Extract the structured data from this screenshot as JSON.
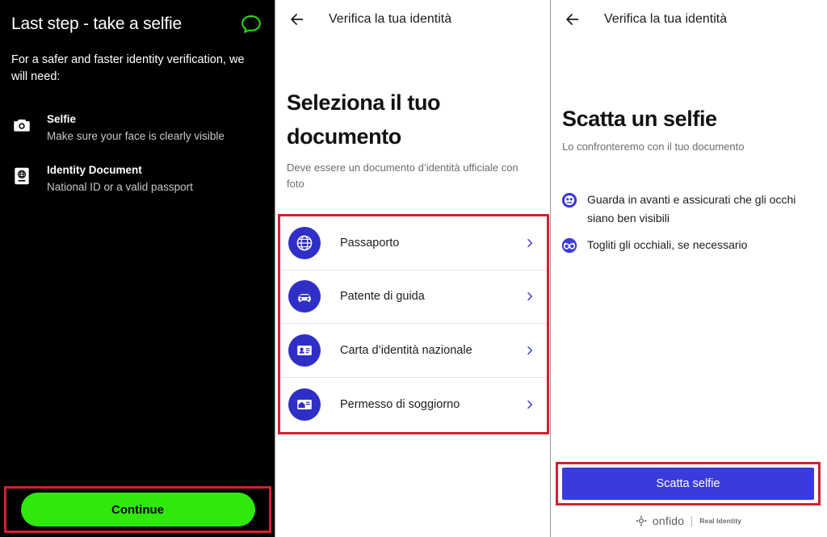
{
  "panel1": {
    "title": "Last step - take a selfie",
    "chat_icon": "chat-bubble-icon",
    "subtitle": "For a safer and faster identity verification, we will need:",
    "requirements": [
      {
        "icon": "camera-icon",
        "title": "Selfie",
        "desc": "Make sure your face is clearly visible"
      },
      {
        "icon": "passport-icon",
        "title": "Identity Document",
        "desc": "National ID or a valid passport"
      }
    ],
    "continue_label": "Continue",
    "continue_color": "#2EE80E",
    "background_color": "#000000"
  },
  "panel2": {
    "header_title": "Verifica la tua identità",
    "back_icon": "back-arrow-icon",
    "heading": "Seleziona il tuo documento",
    "subtitle": "Deve essere un documento d’identità ufficiale con foto",
    "documents": [
      {
        "label": "Passaporto",
        "icon": "globe-icon"
      },
      {
        "label": "Patente di guida",
        "icon": "car-icon"
      },
      {
        "label": "Carta d’identità nazionale",
        "icon": "id-card-icon"
      },
      {
        "label": "Permesso di soggiorno",
        "icon": "residence-permit-icon"
      }
    ],
    "chevron_icon": "chevron-right-icon",
    "icon_color": "#2F2FC7",
    "highlight_color": "#d32030"
  },
  "panel3": {
    "header_title": "Verifica la tua identità",
    "back_icon": "back-arrow-icon",
    "heading": "Scatta un selfie",
    "subtitle": "Lo confronteremo con il tuo documento",
    "tips": [
      {
        "icon": "face-eyes-icon",
        "text": "Guarda in avanti e assicurati che gli occhi siano ben visibili"
      },
      {
        "icon": "glasses-icon",
        "text": "Togliti gli occhiali, se necessario"
      }
    ],
    "selfie_button_label": "Scatta selfie",
    "selfie_button_color": "#3B3BDB",
    "brand": {
      "logo_icon": "onfido-logo-icon",
      "name": "onfido",
      "tagline": "Real Identity"
    }
  }
}
